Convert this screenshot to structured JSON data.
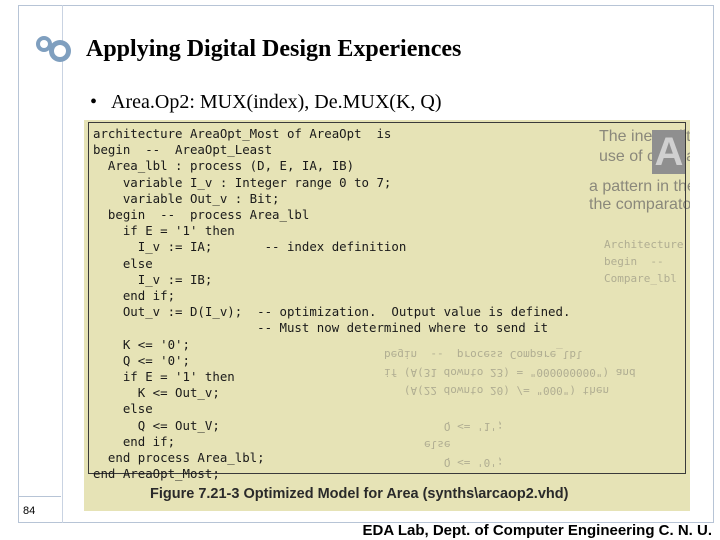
{
  "slide": {
    "title": "Applying Digital Design Experiences",
    "bullet": "Area.Op2: MUX(index), De.MUX(K, Q)",
    "bullet_marker": "•",
    "page_number": "84",
    "footer": "EDA Lab, Dept. of Computer Engineering C. N. U."
  },
  "figure": {
    "code_lines": [
      "architecture AreaOpt_Most of AreaOpt  is",
      "begin  --  AreaOpt_Least",
      "  Area_lbl : process (D, E, IA, IB)",
      "    variable I_v : Integer range 0 to 7;",
      "    variable Out_v : Bit;",
      "  begin  --  process Area_lbl",
      "    if E = '1' then",
      "      I_v := IA;       -- index definition",
      "    else",
      "      I_v := IB;",
      "    end if;",
      "    Out_v := D(I_v);  -- optimization.  Output value is defined.",
      "                      -- Must now determined where to send it",
      "    K <= '0';",
      "    Q <= '0';",
      "    if E = '1' then",
      "      K <= Out_v;",
      "    else",
      "      Q <= Out_V;",
      "    end if;",
      "  end process Area_lbl;",
      "end AreaOpt_Most;"
    ],
    "caption": "Figure 7.21-3 Optimized Model for Area (synths\\arcaop2.vhd)"
  },
  "colors": {
    "paper": "#e6e3b6",
    "ink": "#1a1a1a",
    "logo": "#7f9fbf"
  },
  "icons": {
    "logo": "interlocking-circles-icon"
  }
}
